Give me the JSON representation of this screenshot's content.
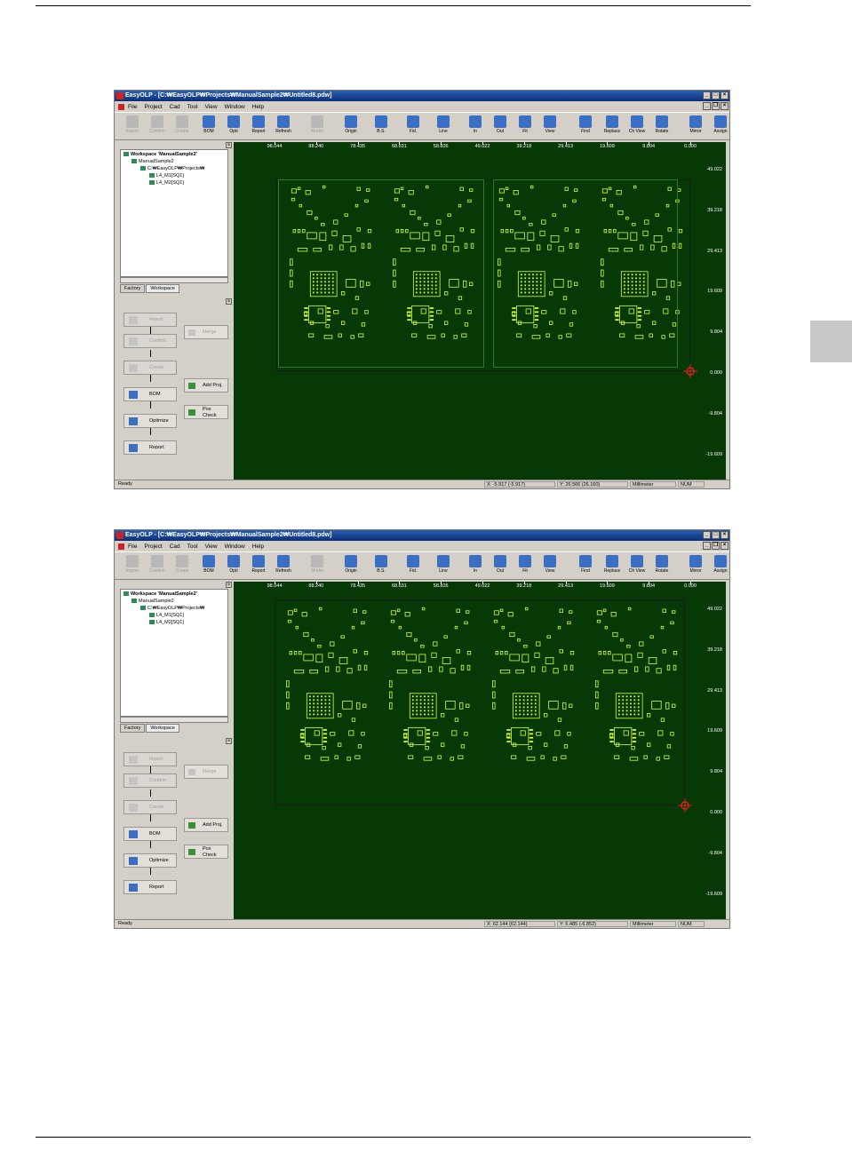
{
  "apps": [
    {
      "title": "EasyOLP - [C:₩EasyOLP₩Projects₩ManualSample2₩Untitled8.pdw]",
      "menu": [
        "File",
        "Project",
        "Cad",
        "Tool",
        "View",
        "Window",
        "Help"
      ],
      "toolbar": [
        "Import",
        "Confirm",
        "Create",
        "BOM",
        "Opti",
        "Report",
        "Refresh",
        "Model",
        "Origin",
        "B.S.",
        "Fid.",
        "Line",
        "In",
        "Out",
        "Fit",
        "View",
        "Find",
        "Replace",
        "Ch View",
        "Rotate",
        "Mirror",
        "Assign"
      ],
      "tree": {
        "root": "Workspace 'ManualSample2'",
        "project": "ManualSample2",
        "path": "C:₩EasyOLP₩Projects₩",
        "items": [
          "L4_M1[SQ1]",
          "L4_M2[SQ1]"
        ]
      },
      "tabs": [
        "Factory",
        "Workspace"
      ],
      "flow": {
        "import": "Import",
        "merge": "Merge",
        "confirm": "Confirm",
        "create": "Create",
        "add_proj": "Add Proj.",
        "bom": "BOM",
        "pos_check_1": "Pos",
        "pos_check_2": "Check",
        "optimize": "Optimize",
        "report": "Report"
      },
      "x_ticks": [
        "98.044",
        "88.240",
        "78.435",
        "68.631",
        "58.826",
        "49.022",
        "39.218",
        "29.413",
        "19.609",
        "9.804",
        "0.000"
      ],
      "y_ticks": [
        "49.022",
        "39.218",
        "29.413",
        "19.609",
        "9.804",
        "0.000",
        "-9.804",
        "-19.609"
      ],
      "layout": "2-panel",
      "status": {
        "ready": "Ready",
        "x": "X: -5.917 (-5.917)",
        "y": "Y: 26.566 (26.160)",
        "unit": "Millimeter",
        "num": "NUM"
      }
    },
    {
      "title": "EasyOLP - [C:₩EasyOLP₩Projects₩ManualSample2₩Untitled8.pdw]",
      "menu": [
        "File",
        "Project",
        "Cad",
        "Tool",
        "View",
        "Window",
        "Help"
      ],
      "toolbar": [
        "Import",
        "Confirm",
        "Create",
        "BOM",
        "Opti",
        "Report",
        "Refresh",
        "Model",
        "Origin",
        "B.S.",
        "Fid.",
        "Line",
        "In",
        "Out",
        "Fit",
        "View",
        "Find",
        "Replace",
        "Ch View",
        "Rotate",
        "Mirror",
        "Assign"
      ],
      "tree": {
        "root": "Workspace 'ManualSample2'",
        "project": "ManualSample2",
        "path": "C:₩EasyOLP₩Projects₩",
        "items": [
          "L4_M1[SQ1]",
          "L4_M2[SQ1]"
        ]
      },
      "tabs": [
        "Factory",
        "Workspace"
      ],
      "flow": {
        "import": "Import",
        "merge": "Merge",
        "confirm": "Confirm",
        "create": "Create",
        "add_proj": "Add Proj.",
        "bom": "BOM",
        "pos_check_1": "Pos",
        "pos_check_2": "Check",
        "optimize": "Optimize",
        "report": "Report"
      },
      "x_ticks": [
        "98.044",
        "88.240",
        "78.435",
        "68.631",
        "58.826",
        "49.022",
        "39.218",
        "29.413",
        "19.609",
        "9.804",
        "0.000"
      ],
      "y_ticks": [
        "49.022",
        "39.218",
        "29.413",
        "19.609",
        "9.804",
        "0.000",
        "-9.804",
        "-19.609"
      ],
      "layout": "4-circuit",
      "status": {
        "ready": "Ready",
        "x": "X: 62.144 (62.144)",
        "y": "Y: 6.485 (-6.852)",
        "unit": "Millimeter",
        "num": "NUM"
      }
    }
  ],
  "colors": {
    "canvas": "#063906",
    "trace": "#d7ff3c",
    "titlebar": "#0a2f7a"
  }
}
